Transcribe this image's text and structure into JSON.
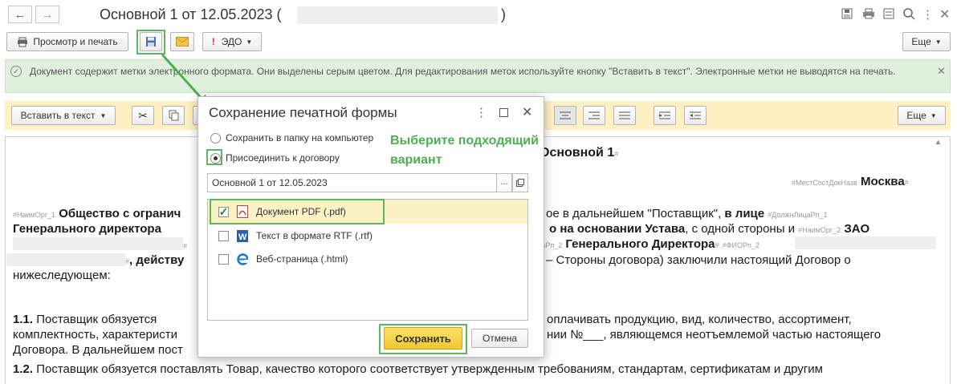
{
  "window": {
    "title": "Основной 1 от 12.05.2023 (",
    "title_close": ")"
  },
  "toolbar": {
    "preview_print": "Просмотр и печать",
    "edo": "ЭДО",
    "more": "Еще"
  },
  "info_bar": {
    "text": "Документ содержит метки электронного формата. Они выделены серым цветом. Для редактирования меток используйте кнопку \"Вставить в текст\". Электронные метки не выводятся на печать."
  },
  "editor_toolbar": {
    "insert_text": "Вставить в текст",
    "more": "Еще"
  },
  "document": {
    "title_part": "Основной 1",
    "tag_hash": "#",
    "tag_city": "#МестСостДокНазв",
    "city": "Москва",
    "tag_org1": "#НаимОрг_1",
    "line1_bold": "Общество с огранич",
    "line1_tail_normal": "ое в дальнейшем \"Поставщик\",",
    "line1_tail_bold": "в лице",
    "tag_pos1": "#ДолжнЛицаРп_1",
    "line2_bold": "Генерального директора",
    "line2_tail_bold": "о на основании Устава",
    "line2_tail_normal": ", с одной стороны и",
    "tag_org2": "#НаимОрг_2",
    "zao": "ЗАО",
    "tag_pos2": "#ДолжнЛицаРп_2",
    "gen_director": "Генерального Директора",
    "tag_fio2": "#ФИОРп_2",
    "line4_bold": ", действу",
    "line4_tail": "– Стороны договора) заключили настоящий Договор о",
    "line5": "нижеследующем:",
    "p11_num": "1.1.",
    "p11_a": "Поставщик обязуется",
    "p11_a_tail": "оплачивать продукцию, вид, количество, ассортимент,",
    "p11_b": "комплектность, характеристи",
    "p11_b_tail": "нии №___, являющемся неотъемлемой частью настоящего",
    "p11_c": "Договора. В дальнейшем пост",
    "p12_num": "1.2.",
    "p12": "Поставщик обязуется поставлять Товар, качество которого соответствует утвержденным требованиям, стандартам, сертификатам и другим"
  },
  "dialog": {
    "title": "Сохранение печатной формы",
    "option_folder": "Сохранить в папку на компьютер",
    "option_attach": "Присоединить к договору",
    "contract_value": "Основной 1 от 12.05.2023",
    "formats": [
      {
        "label": "Документ PDF (.pdf)",
        "checked": true
      },
      {
        "label": "Текст в формате RTF (.rtf)",
        "checked": false
      },
      {
        "label": "Веб-страница (.html)",
        "checked": false
      }
    ],
    "save": "Сохранить",
    "cancel": "Отмена",
    "ellipsis": "...",
    "menu_dots": "⋮"
  },
  "annotation": {
    "hint": "Выберите подходящий вариант"
  },
  "colors": {
    "highlight_green": "#5cb85c",
    "annotation_green": "#4caf50",
    "info_bg": "#dff0dd",
    "editor_bar_bg": "#fdf0c2",
    "save_yellow": "#f7d43e",
    "pdf_red": "#d9382c",
    "word_blue": "#2a5fae"
  }
}
